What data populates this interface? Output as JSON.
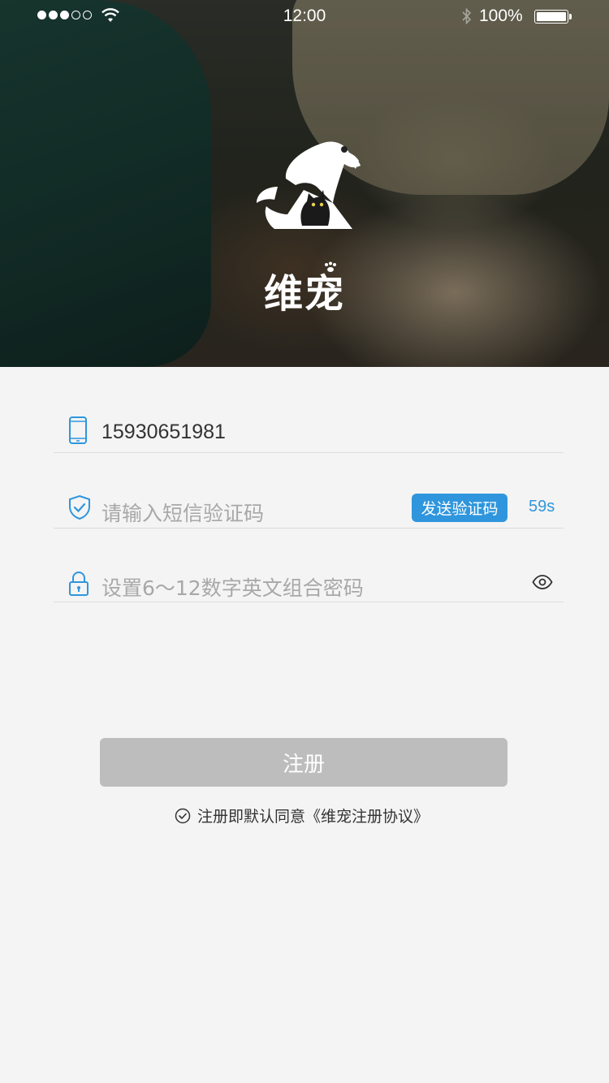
{
  "status_bar": {
    "time": "12:00",
    "battery": "100%",
    "signal_bars": 3,
    "signal_total": 5
  },
  "brand": {
    "name": "维宠"
  },
  "form": {
    "phone": {
      "icon": "phone-icon",
      "value": "15930651981"
    },
    "sms_code": {
      "icon": "shield-check-icon",
      "placeholder": "请输入短信验证码",
      "send_label": "发送验证码",
      "countdown": "59s"
    },
    "password": {
      "icon": "lock-icon",
      "placeholder": "设置6～12数字英文组合密码",
      "toggle_icon": "eye-icon"
    }
  },
  "register": {
    "label": "注册",
    "agreement": "注册即默认同意《维宠注册协议》"
  },
  "colors": {
    "accent": "#2f96dd",
    "disabled_button": "#bdbdbd",
    "background": "#f4f4f4"
  }
}
